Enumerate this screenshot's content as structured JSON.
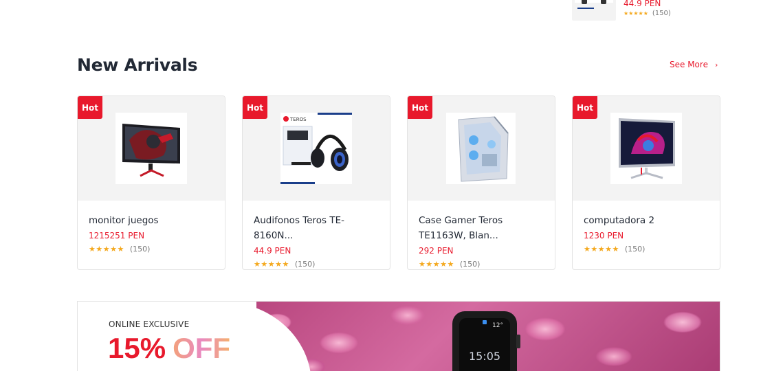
{
  "top_item": {
    "price": "44.9 PEN",
    "rating_stars": "★★★★★",
    "rating_count": "(150)",
    "image_icon": "headphones-icon"
  },
  "section": {
    "title": "New Arrivals",
    "see_more": "See More",
    "chevron": "›"
  },
  "products": [
    {
      "badge": "Hot",
      "title": "monitor juegos",
      "price": "1215251 PEN",
      "stars": "★★★★★",
      "count": "(150)",
      "rating": 5,
      "image": "gaming-monitor-icon"
    },
    {
      "badge": "Hot",
      "title": "Audifonos Teros TE-8160N...",
      "price": "44.9 PEN",
      "stars": "★★★★★",
      "count": "(150)",
      "rating": 5,
      "image": "headset-icon"
    },
    {
      "badge": "Hot",
      "title": "Case Gamer Teros TE1163W, Blan...",
      "price": "292 PEN",
      "stars": "★★★★★",
      "count": "(150)",
      "rating": 5,
      "image": "pc-case-icon"
    },
    {
      "badge": "Hot",
      "title": "computadora 2",
      "price": "1230 PEN",
      "stars": "★★★★★",
      "count": "(150)",
      "rating": 5,
      "image": "monitor-icon"
    }
  ],
  "banner": {
    "kicker": "ONLINE EXCLUSIVE",
    "percent": "15%",
    "off_word": "OFF",
    "watch_date": "12°",
    "watch_time": "15:05"
  },
  "colors": {
    "accent": "#e8192c",
    "star": "#f4a81d",
    "text": "#222935",
    "image_bg": "#f3f3f3"
  }
}
